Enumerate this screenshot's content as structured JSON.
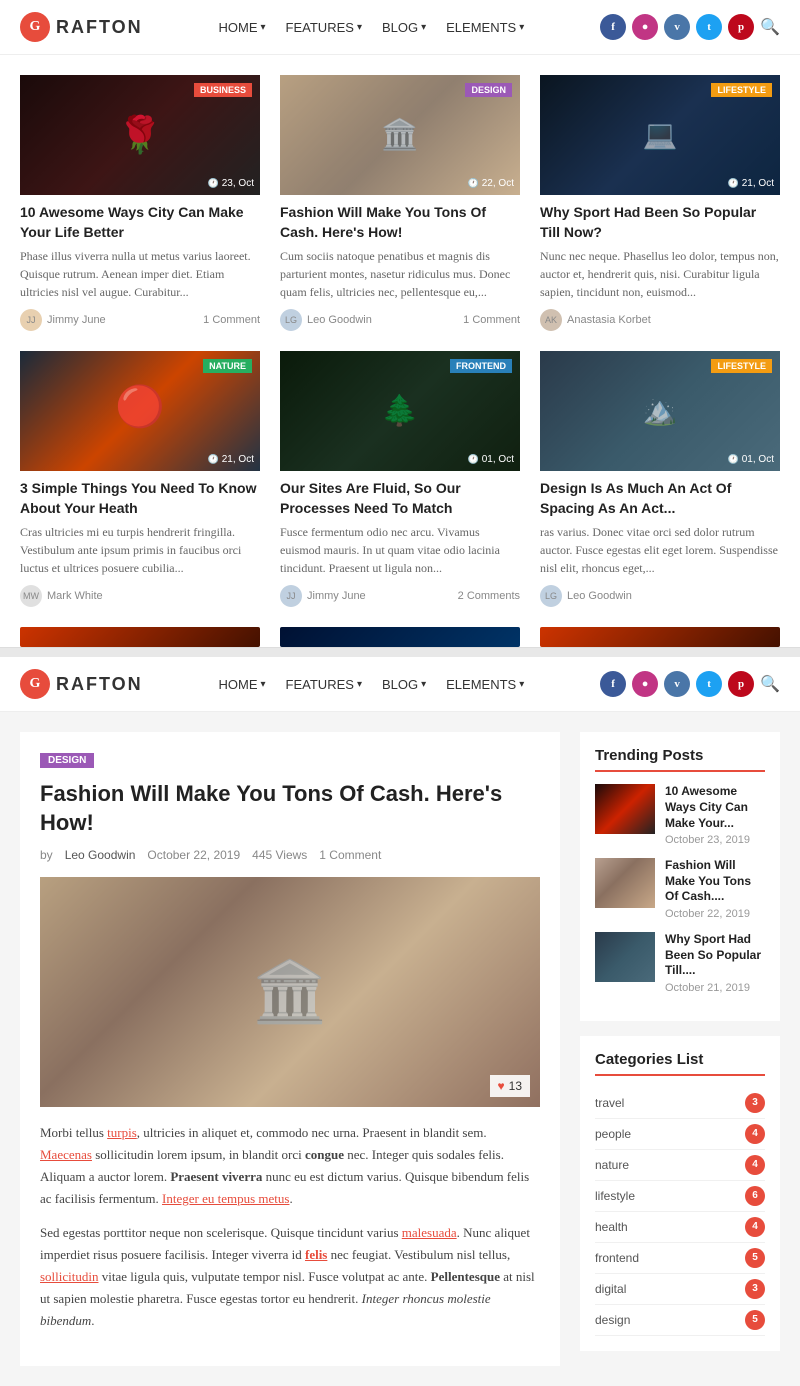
{
  "site": {
    "name": "RAFTON",
    "logo_letter": "G"
  },
  "nav": {
    "items": [
      {
        "label": "HOME",
        "has_arrow": true
      },
      {
        "label": "FEATURES",
        "has_arrow": true
      },
      {
        "label": "BLOG",
        "has_arrow": true
      },
      {
        "label": "ELEMENTS",
        "has_arrow": true
      }
    ]
  },
  "social": {
    "fb": "f",
    "ig": "in",
    "vk": "vk",
    "tw": "t",
    "pt": "p"
  },
  "grid_articles": [
    {
      "id": 1,
      "category": "BUSINESS",
      "badge_class": "badge-business",
      "img_class": "img-rose",
      "date": "23, Oct",
      "title": "10 Awesome Ways City Can Make Your Life Better",
      "excerpt": "Phase illus viverra nulla ut metus varius laoreet. Quisque rutrum. Aenean imper diet. Etiam ultricies nisl vel augue. Curabitur...",
      "author": "Jimmy June",
      "comments": "1 Comment",
      "author_bg": "#e8d0b0"
    },
    {
      "id": 2,
      "category": "DESIGN",
      "badge_class": "badge-design",
      "img_class": "img-capitol",
      "date": "22, Oct",
      "title": "Fashion Will Make You Tons Of Cash. Here's How!",
      "excerpt": "Cum sociis natoque penatibus et magnis dis parturient montes, nasetur ridiculus mus. Donec quam felis, ultricies nec, pellentesque eu,...",
      "author": "Leo Goodwin",
      "comments": "1 Comment",
      "author_bg": "#c0d0e0"
    },
    {
      "id": 3,
      "category": "LIFESTYLE",
      "badge_class": "badge-lifestyle",
      "img_class": "img-tech",
      "date": "21, Oct",
      "title": "Why Sport Had Been So Popular Till Now?",
      "excerpt": "Nunc nec neque. Phasellus leo dolor, tempus non, auctor et, hendrerit quis, nisi. Curabitur ligula sapien, tincidunt non, euismod...",
      "author": "Anastasia Korbet",
      "comments": "",
      "author_bg": "#d0c0b0"
    },
    {
      "id": 4,
      "category": "NATURE",
      "badge_class": "badge-nature",
      "img_class": "img-orange",
      "date": "21, Oct",
      "title": "3 Simple Things You Need To Know About Your Heath",
      "excerpt": "Cras ultricies mi eu turpis hendrerit fringilla. Vestibulum ante ipsum primis in faucibus orci luctus et ultrices posuere cubilia...",
      "author": "Mark White",
      "comments": "",
      "author_bg": "#e0e0e0"
    },
    {
      "id": 5,
      "category": "FRONTEND",
      "badge_class": "badge-frontend",
      "img_class": "img-forest",
      "date": "01, Oct",
      "title": "Our Sites Are Fluid, So Our Processes Need To Match",
      "excerpt": "Fusce fermentum odio nec arcu. Vivamus euismod mauris. In ut quam vitae odio lacinia tincidunt. Praesent ut ligula non...",
      "author": "Jimmy June",
      "comments": "2 Comments",
      "author_bg": "#c0d0e0"
    },
    {
      "id": 6,
      "category": "LIFESTYLE",
      "badge_class": "badge-lifestyle",
      "img_class": "img-lake",
      "date": "01, Oct",
      "title": "Design Is As Much An Act Of Spacing As An Act...",
      "excerpt": "ras varius. Donec vitae orci sed dolor rutrum auctor. Fusce egestas elit eget lorem. Suspendisse nisl elit, rhoncus eget,...",
      "author": "Leo Goodwin",
      "comments": "",
      "author_bg": "#c0d0e0"
    }
  ],
  "blog_post": {
    "category": "DESIGN",
    "title": "Fashion Will Make You Tons Of Cash. Here's How!",
    "by_label": "by",
    "author": "Leo Goodwin",
    "date": "October 22, 2019",
    "views": "445 Views",
    "comments": "1 Comment",
    "like_count": "13",
    "body_p1": "Morbi tellus turpis, ultricies in aliquet et, commodo nec urna. Praesent in blandit sem. Maecenas sollicitudin lorem ipsum, in blandit orci congue nec. Integer quis sodales felis. Aliquam a auctor lorem. Praesent viverra nunc eu est dictum varius. Quisque bibendum felis ac facilisis fermentum. Integer eu tempus metus.",
    "body_p2": "Sed egestas porttitor neque non scelerisque. Quisque tincidunt varius malesuada. Nunc aliquet imperdiet risus posuere facilisis. Integer viverra id felis nec feugiat. Vestibulum nisl tellus, sollicitudin vitae ligula quis, vulputate tempor nisl. Fusce volutpat ac ante. Pellentesque at nisl ut sapien molestie pharetra. Fusce egestas tortor eu hendrerit. Integer rhoncus molestie bibendum."
  },
  "trending": {
    "title": "Trending Posts",
    "items": [
      {
        "img_class": "trending-img-1",
        "title": "10 Awesome Ways City Can Make Your...",
        "date": "October 23, 2019"
      },
      {
        "img_class": "trending-img-2",
        "title": "Fashion Will Make You Tons Of Cash....",
        "date": "October 22, 2019"
      },
      {
        "img_class": "trending-img-3",
        "title": "Why Sport Had Been So Popular Till....",
        "date": "October 21, 2019"
      }
    ]
  },
  "categories": {
    "title": "Categories List",
    "items": [
      {
        "name": "travel",
        "count": "3"
      },
      {
        "name": "people",
        "count": "4"
      },
      {
        "name": "nature",
        "count": "4"
      },
      {
        "name": "lifestyle",
        "count": "6"
      },
      {
        "name": "health",
        "count": "4"
      },
      {
        "name": "frontend",
        "count": "5"
      },
      {
        "name": "digital",
        "count": "3"
      },
      {
        "name": "design",
        "count": "5"
      }
    ]
  }
}
